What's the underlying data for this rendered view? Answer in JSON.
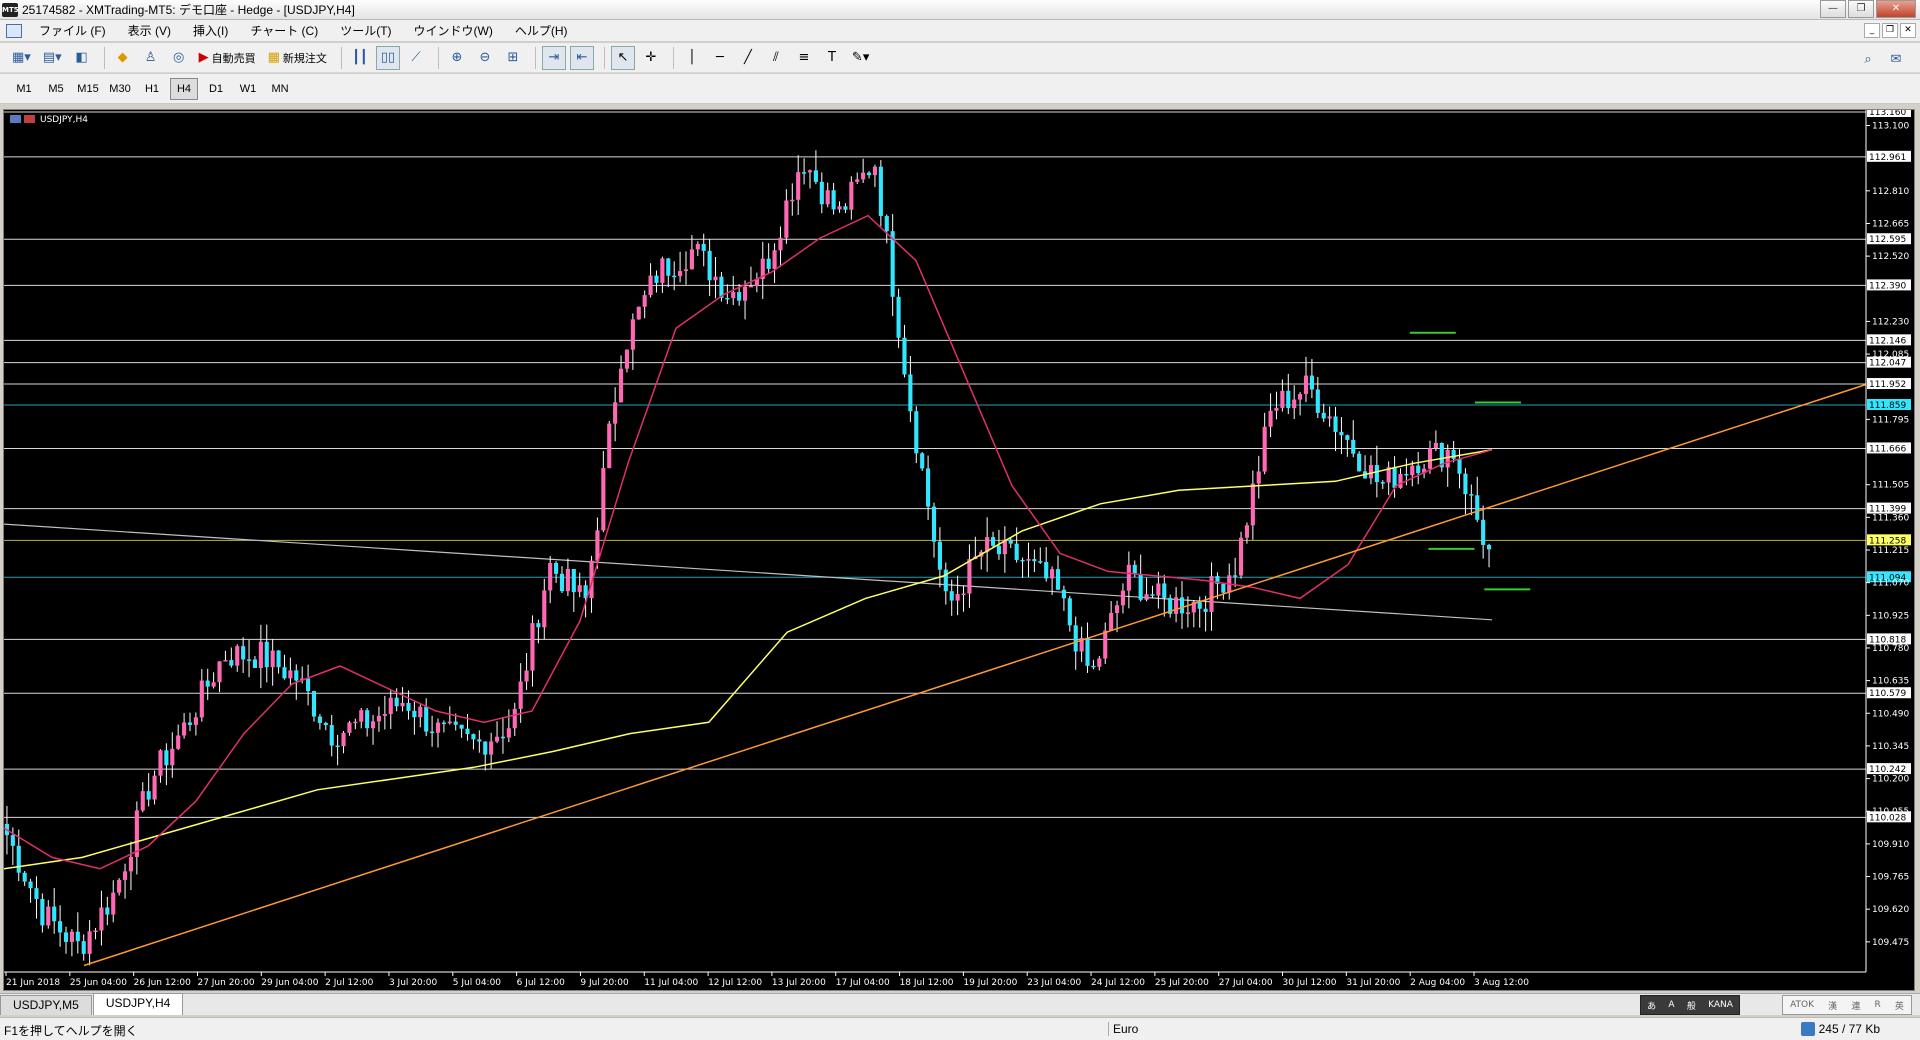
{
  "window": {
    "title": "25174582 - XMTrading-MT5: デモ口座 - Hedge - [USDJPY,H4]",
    "app_icon": "mt5-logo-icon",
    "controls": [
      "—",
      "❐",
      "✕"
    ]
  },
  "menu": {
    "items": [
      "ファイル (F)",
      "表示 (V)",
      "挿入(I)",
      "チャート (C)",
      "ツール(T)",
      "ウインドウ(W)",
      "ヘルプ(H)"
    ],
    "mdi_controls": [
      "_",
      "❐",
      "✕"
    ]
  },
  "toolbar": {
    "auto_trade_label": "自動売買",
    "new_order_label": "新規注文"
  },
  "periods": {
    "items": [
      "M1",
      "M5",
      "M15",
      "M30",
      "H1",
      "H4",
      "D1",
      "W1",
      "MN"
    ],
    "active": "H4"
  },
  "chart_data": {
    "type": "candlestick",
    "symbol_label": "USDJPY,H4",
    "colors": {
      "background": "#000000",
      "bull": "#ff69b4",
      "bear": "#33e6ff",
      "ma_fast": "#e0306a",
      "ma_slow": "#ffff66",
      "trendline": "#ff9933",
      "hline": "#ffffff",
      "tick_label_box": "#ffffff",
      "highlight_cyan": "#33e6ff",
      "highlight_yellow": "#ffff66",
      "gray_line": "#c0c0c0",
      "green_marker": "#33cc33"
    },
    "ylim": [
      109.35,
      113.16
    ],
    "y_ticks": [
      "113.160",
      "113.100",
      "112.961",
      "112.810",
      "112.665",
      "112.595",
      "112.520",
      "112.390",
      "112.230",
      "112.146",
      "112.085",
      "112.047",
      "111.952",
      "111.859",
      "111.795",
      "111.666",
      "111.505",
      "111.399",
      "111.360",
      "111.258",
      "111.215",
      "111.094",
      "111.070",
      "110.925",
      "110.818",
      "110.780",
      "110.635",
      "110.579",
      "110.490",
      "110.345",
      "110.242",
      "110.200",
      "110.055",
      "110.028",
      "109.910",
      "109.765",
      "109.620",
      "109.475"
    ],
    "boxed_levels": [
      113.16,
      112.961,
      112.595,
      112.39,
      112.146,
      112.047,
      111.952,
      111.666,
      111.399,
      110.818,
      110.579,
      110.242,
      110.028
    ],
    "hlines": [
      113.16,
      112.961,
      112.595,
      112.39,
      112.146,
      112.047,
      111.952,
      111.666,
      111.399,
      110.818,
      110.579,
      110.242,
      110.028
    ],
    "highlight_levels": [
      {
        "value": 111.859,
        "label": "111.859",
        "color": "cyan"
      },
      {
        "value": 111.258,
        "label": "111.258",
        "color": "yellow"
      },
      {
        "value": 111.094,
        "label": "111.094",
        "color": "cyan"
      }
    ],
    "x_labels": [
      "21 Jun 2018",
      "25 Jun 04:00",
      "26 Jun 12:00",
      "27 Jun 20:00",
      "29 Jun 04:00",
      "2 Jul 12:00",
      "3 Jul 20:00",
      "5 Jul 04:00",
      "6 Jul 12:00",
      "9 Jul 20:00",
      "11 Jul 04:00",
      "12 Jul 12:00",
      "13 Jul 20:00",
      "17 Jul 04:00",
      "18 Jul 12:00",
      "19 Jul 20:00",
      "23 Jul 04:00",
      "24 Jul 12:00",
      "25 Jul 20:00",
      "27 Jul 04:00",
      "30 Jul 12:00",
      "31 Jul 20:00",
      "2 Aug 04:00",
      "3 Aug 12:00"
    ],
    "close_path": [
      109.95,
      109.6,
      109.45,
      109.7,
      110.2,
      110.45,
      110.75,
      110.75,
      110.65,
      110.4,
      110.45,
      110.55,
      110.4,
      110.35,
      110.45,
      111.15,
      110.98,
      112.1,
      112.45,
      112.55,
      112.35,
      112.48,
      112.96,
      112.7,
      112.95,
      111.85,
      110.95,
      111.22,
      111.18,
      111.05,
      110.65,
      111.1,
      110.98,
      110.98,
      111.15,
      111.85,
      111.94,
      111.72,
      111.5,
      111.62,
      111.66,
      111.2
    ],
    "ma_fast_path": [
      109.98,
      109.85,
      109.8,
      109.9,
      110.1,
      110.4,
      110.62,
      110.7,
      110.6,
      110.5,
      110.45,
      110.5,
      110.9,
      111.6,
      112.2,
      112.35,
      112.45,
      112.6,
      112.7,
      112.5,
      112.0,
      111.5,
      111.2,
      111.12,
      111.1,
      111.08,
      111.05,
      111.0,
      111.15,
      111.5,
      111.6,
      111.66
    ],
    "ma_slow_path": [
      109.8,
      109.85,
      109.95,
      110.05,
      110.15,
      110.2,
      110.25,
      110.32,
      110.4,
      110.45,
      110.85,
      111.0,
      111.1,
      111.3,
      111.42,
      111.48,
      111.5,
      111.52,
      111.6,
      111.66
    ],
    "trendline": {
      "from": 109.37,
      "to": 111.95
    },
    "gray_line": {
      "from": 111.33,
      "to": 110.905
    },
    "green_markers": [
      {
        "value": 112.18,
        "pos": 0.755
      },
      {
        "value": 111.87,
        "pos": 0.79
      },
      {
        "value": 111.22,
        "pos": 0.765
      },
      {
        "value": 111.04,
        "pos": 0.795
      }
    ]
  },
  "tabs": {
    "items": [
      "USDJPY,M5",
      "USDJPY,H4"
    ],
    "active": "USDJPY,H4"
  },
  "ime": {
    "items": [
      "あ",
      "A",
      "般",
      "KANA",
      "ATOK",
      "漢",
      "連",
      "R",
      "英"
    ]
  },
  "status": {
    "help": "F1を押してヘルプを開く",
    "profile": "Euro",
    "traffic": "245 / 77 Kb"
  }
}
